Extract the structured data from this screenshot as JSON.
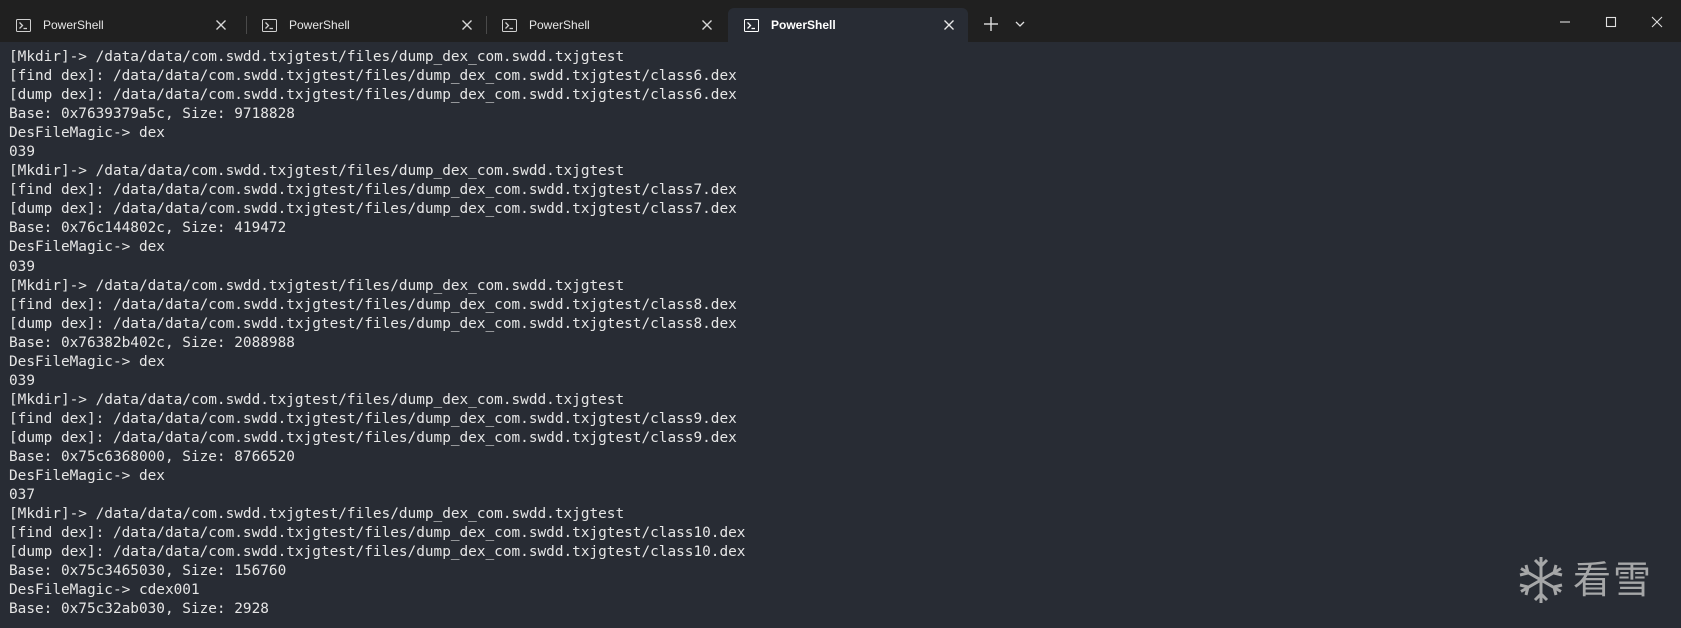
{
  "tabs": [
    {
      "label": "PowerShell",
      "active": false
    },
    {
      "label": "PowerShell",
      "active": false
    },
    {
      "label": "PowerShell",
      "active": false
    },
    {
      "label": "PowerShell",
      "active": true
    }
  ],
  "icons": {
    "tab_icon": "powershell-icon",
    "tab_close": "close-icon",
    "new_tab": "plus-icon",
    "tab_dropdown": "chevron-down-icon",
    "minimize": "minimize-icon",
    "maximize": "maximize-icon",
    "close_window": "close-icon",
    "watermark_logo": "snowflake-icon"
  },
  "colors": {
    "titlebar": "#202020",
    "terminal_bg": "#282c34",
    "text": "#e6e6e6"
  },
  "terminal": {
    "lines": [
      "[Mkdir]-> /data/data/com.swdd.txjgtest/files/dump_dex_com.swdd.txjgtest",
      "[find dex]: /data/data/com.swdd.txjgtest/files/dump_dex_com.swdd.txjgtest/class6.dex",
      "[dump dex]: /data/data/com.swdd.txjgtest/files/dump_dex_com.swdd.txjgtest/class6.dex",
      "Base: 0x7639379a5c, Size: 9718828",
      "DesFileMagic-> dex",
      "039",
      "[Mkdir]-> /data/data/com.swdd.txjgtest/files/dump_dex_com.swdd.txjgtest",
      "[find dex]: /data/data/com.swdd.txjgtest/files/dump_dex_com.swdd.txjgtest/class7.dex",
      "[dump dex]: /data/data/com.swdd.txjgtest/files/dump_dex_com.swdd.txjgtest/class7.dex",
      "Base: 0x76c144802c, Size: 419472",
      "DesFileMagic-> dex",
      "039",
      "[Mkdir]-> /data/data/com.swdd.txjgtest/files/dump_dex_com.swdd.txjgtest",
      "[find dex]: /data/data/com.swdd.txjgtest/files/dump_dex_com.swdd.txjgtest/class8.dex",
      "[dump dex]: /data/data/com.swdd.txjgtest/files/dump_dex_com.swdd.txjgtest/class8.dex",
      "Base: 0x76382b402c, Size: 2088988",
      "DesFileMagic-> dex",
      "039",
      "[Mkdir]-> /data/data/com.swdd.txjgtest/files/dump_dex_com.swdd.txjgtest",
      "[find dex]: /data/data/com.swdd.txjgtest/files/dump_dex_com.swdd.txjgtest/class9.dex",
      "[dump dex]: /data/data/com.swdd.txjgtest/files/dump_dex_com.swdd.txjgtest/class9.dex",
      "Base: 0x75c6368000, Size: 8766520",
      "DesFileMagic-> dex",
      "037",
      "[Mkdir]-> /data/data/com.swdd.txjgtest/files/dump_dex_com.swdd.txjgtest",
      "[find dex]: /data/data/com.swdd.txjgtest/files/dump_dex_com.swdd.txjgtest/class10.dex",
      "[dump dex]: /data/data/com.swdd.txjgtest/files/dump_dex_com.swdd.txjgtest/class10.dex",
      "Base: 0x75c3465030, Size: 156760",
      "DesFileMagic-> cdex001",
      "Base: 0x75c32ab030, Size: 2928"
    ]
  },
  "watermark": {
    "text": "看雪"
  }
}
